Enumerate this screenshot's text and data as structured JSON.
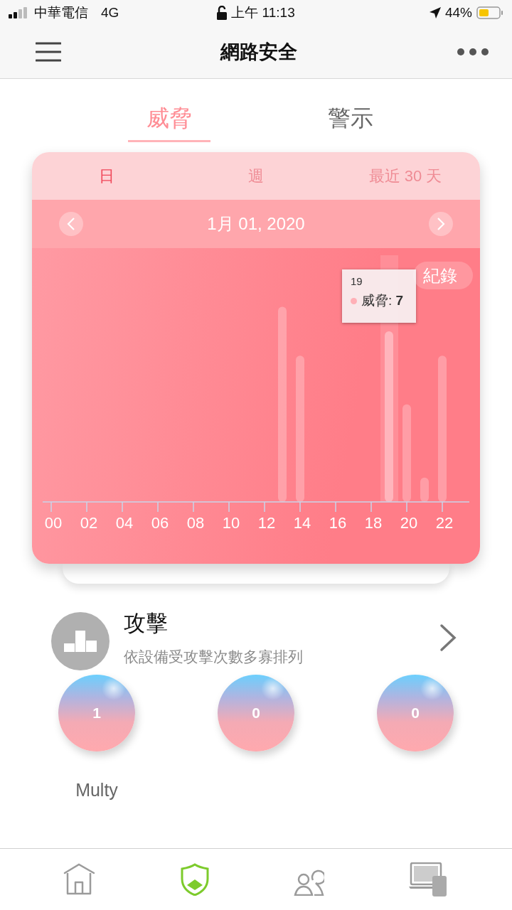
{
  "status_bar": {
    "carrier": "中華電信",
    "network": "4G",
    "time": "上午 11:13",
    "battery": "44%"
  },
  "nav": {
    "title": "網路安全"
  },
  "tabs": [
    {
      "label": "威脅",
      "selected": true
    },
    {
      "label": "警示",
      "selected": false
    }
  ],
  "periods": [
    {
      "label": "日",
      "selected": true
    },
    {
      "label": "週",
      "selected": false
    },
    {
      "label": "最近 30 天",
      "selected": false
    }
  ],
  "date": "1月 01, 2020",
  "log_button": "紀錄",
  "tooltip": {
    "title": "19",
    "series": "威脅:",
    "value": "7"
  },
  "hour_labels": [
    "00",
    "02",
    "04",
    "06",
    "08",
    "10",
    "12",
    "14",
    "16",
    "18",
    "20",
    "22"
  ],
  "attack": {
    "title": "攻擊",
    "subtitle": "依設備受攻擊次數多寡排列",
    "devices": [
      {
        "count": "1",
        "name": "Multy"
      },
      {
        "count": "0"
      },
      {
        "count": "0"
      }
    ]
  },
  "bottom_tabs": [
    {
      "kind": "home",
      "selected": false
    },
    {
      "kind": "shield",
      "selected": true
    },
    {
      "kind": "people",
      "selected": false
    },
    {
      "kind": "devices",
      "selected": false
    }
  ]
}
